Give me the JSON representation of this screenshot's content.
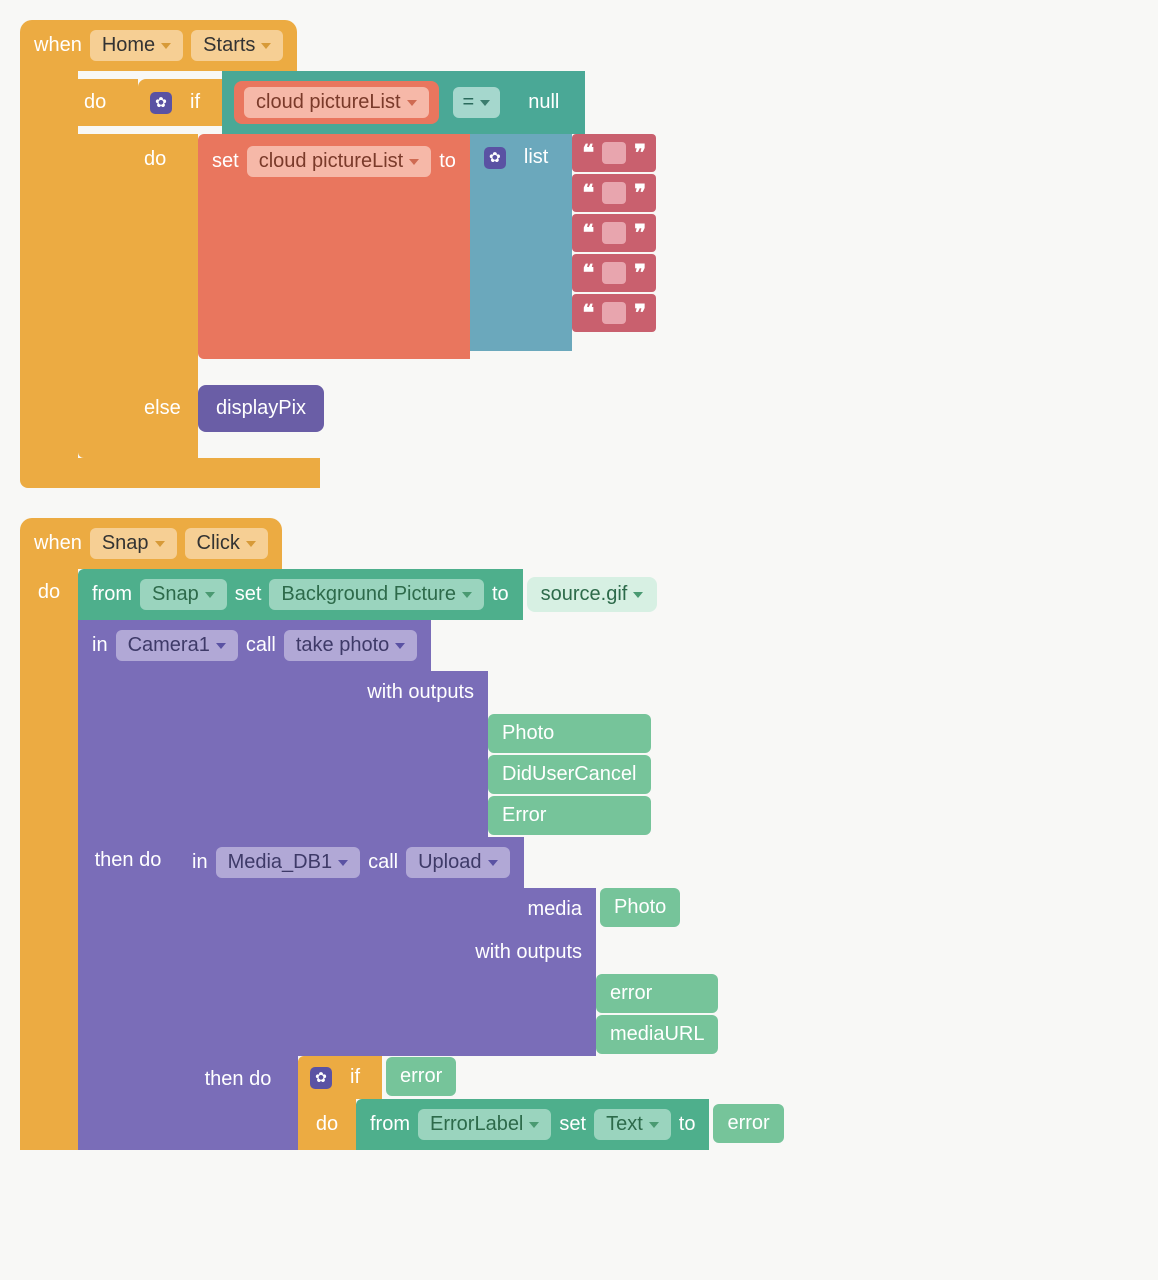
{
  "block1": {
    "hat": {
      "when": "when",
      "screen": "Home",
      "event": "Starts"
    },
    "do": "do",
    "if_kw": "if",
    "cloud_var": "cloud pictureList",
    "eq_op": "=",
    "null_kw": "null",
    "set_kw": "set",
    "to_kw": "to",
    "list_kw": "list",
    "else_kw": "else",
    "displayPix": "displayPix"
  },
  "block2": {
    "hat": {
      "when": "when",
      "screen": "Snap",
      "event": "Click"
    },
    "do": "do",
    "from_kw": "from",
    "snap": "Snap",
    "set_kw": "set",
    "bg_pic": "Background Picture",
    "to_kw": "to",
    "source": "source.gif",
    "in_kw": "in",
    "camera": "Camera1",
    "call_kw": "call",
    "take_photo": "take photo",
    "with_outputs": "with outputs",
    "photo": "Photo",
    "did_cancel": "DidUserCancel",
    "error": "Error",
    "then_do": "then do",
    "media_db": "Media_DB1",
    "upload": "Upload",
    "media_kw": "media",
    "error_lc": "error",
    "mediaURL": "mediaURL",
    "if_kw": "if",
    "error_label": "ErrorLabel",
    "text_kw": "Text"
  }
}
